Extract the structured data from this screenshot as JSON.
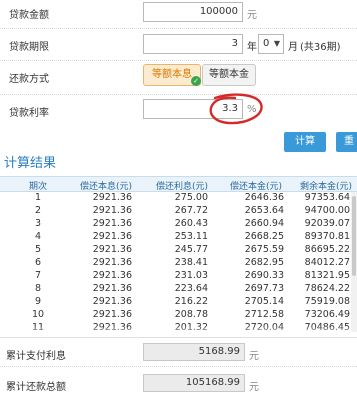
{
  "form": {
    "amount": {
      "label": "贷款金额",
      "value": "100000",
      "unit": "元"
    },
    "term": {
      "label": "贷款期限",
      "years": "3",
      "year_unit": "年",
      "months": "0",
      "month_unit": "月",
      "total": "(共36期)"
    },
    "method": {
      "label": "还款方式",
      "option_a": "等额本息",
      "option_b": "等额本金"
    },
    "rate": {
      "label": "贷款利率",
      "value": "3.3",
      "unit": "%"
    }
  },
  "buttons": {
    "calc": "计算",
    "reset": "重"
  },
  "results": {
    "title": "计算结果",
    "columns": [
      "期次",
      "偿还本息(元)",
      "偿还利息(元)",
      "偿还本金(元)",
      "剩余本金(元)"
    ],
    "rows": [
      [
        "1",
        "2921.36",
        "275.00",
        "2646.36",
        "97353.64"
      ],
      [
        "2",
        "2921.36",
        "267.72",
        "2653.64",
        "94700.00"
      ],
      [
        "3",
        "2921.36",
        "260.43",
        "2660.94",
        "92039.07"
      ],
      [
        "4",
        "2921.36",
        "253.11",
        "2668.25",
        "89370.81"
      ],
      [
        "5",
        "2921.36",
        "245.77",
        "2675.59",
        "86695.22"
      ],
      [
        "6",
        "2921.36",
        "238.41",
        "2682.95",
        "84012.27"
      ],
      [
        "7",
        "2921.36",
        "231.03",
        "2690.33",
        "81321.95"
      ],
      [
        "8",
        "2921.36",
        "223.64",
        "2697.73",
        "78624.22"
      ],
      [
        "9",
        "2921.36",
        "216.22",
        "2705.14",
        "75919.08"
      ],
      [
        "10",
        "2921.36",
        "208.78",
        "2712.58",
        "73206.49"
      ],
      [
        "11",
        "2921.36",
        "201.32",
        "2720.04",
        "70486.45"
      ]
    ]
  },
  "totals": {
    "interest_label": "累计支付利息",
    "interest_value": "5168.99",
    "interest_unit": "元",
    "total_label": "累计还款总额",
    "total_value": "105168.99",
    "total_unit": "元"
  },
  "colors": {
    "accent": "#3a9ad9",
    "annotation": "#d42a2a",
    "active_option": "#d97a00"
  }
}
